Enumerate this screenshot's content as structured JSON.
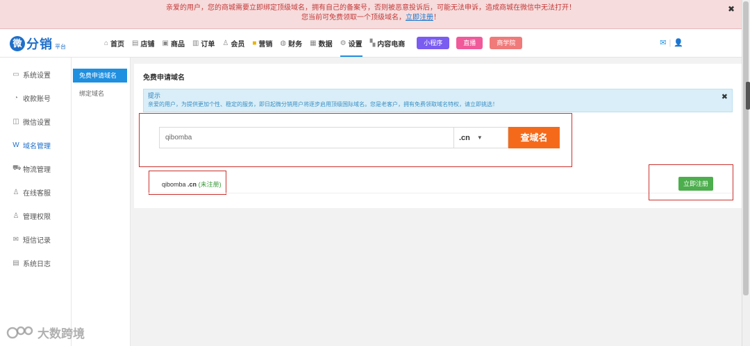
{
  "banner": {
    "line1": "亲爱的用户，您的商城需要立即绑定顶级域名，拥有自己的备案号，否则被恶意投诉后，可能无法申诉，造成商城在微信中无法打开！",
    "line2_prefix": "您当前可免费领取一个顶级域名，",
    "line2_link": "立即注册",
    "line2_suffix": "！",
    "close": "✖"
  },
  "logo": {
    "mark": "微",
    "text": "分销",
    "sub": "平台"
  },
  "nav": {
    "items": [
      {
        "icon": "⌂",
        "label": "首页"
      },
      {
        "icon": "▤",
        "label": "店铺"
      },
      {
        "icon": "▣",
        "label": "商品"
      },
      {
        "icon": "▥",
        "label": "订单"
      },
      {
        "icon": "♙",
        "label": "会员"
      },
      {
        "icon": "■",
        "label": "营销"
      },
      {
        "icon": "◍",
        "label": "财务"
      },
      {
        "icon": "▦",
        "label": "数据"
      },
      {
        "icon": "⚙",
        "label": "设置"
      },
      {
        "icon": "▚",
        "label": "内容电商"
      }
    ],
    "pills": [
      "小程序",
      "直播",
      "商学院"
    ]
  },
  "header_right": {
    "mail_icon": "✉",
    "sep": "|",
    "user_icon": "👤"
  },
  "sidebar": {
    "items": [
      {
        "icon": "▭",
        "label": "系统设置"
      },
      {
        "icon": "◔",
        "label": "收款账号"
      },
      {
        "icon": "◫",
        "label": "微信设置"
      },
      {
        "icon": "W",
        "label": "域名管理"
      },
      {
        "icon": "⛟",
        "label": "物流管理"
      },
      {
        "icon": "♙",
        "label": "在线客服"
      },
      {
        "icon": "♙",
        "label": "管理权限"
      },
      {
        "icon": "✉",
        "label": "短信记录"
      },
      {
        "icon": "▤",
        "label": "系统日志"
      }
    ]
  },
  "subnav": {
    "items": [
      "免费申请域名",
      "绑定域名"
    ]
  },
  "main": {
    "title": "免费申请域名",
    "tip": {
      "title": "提示",
      "body": "亲爱的用户，为提供更加个性、稳定的服务，即日起微分销用户将逐步启用顶级国际域名。您是老客户，拥有免费领取域名特权，请立即挑选！",
      "close": "✖"
    },
    "search": {
      "value": "qibomba",
      "suffix": ".cn",
      "button": "查域名"
    },
    "result": {
      "name": "qibomba",
      "ext": ".cn",
      "status": "(未注册)",
      "register_button": "立即注册"
    }
  },
  "watermark": {
    "text": "大数跨境"
  }
}
